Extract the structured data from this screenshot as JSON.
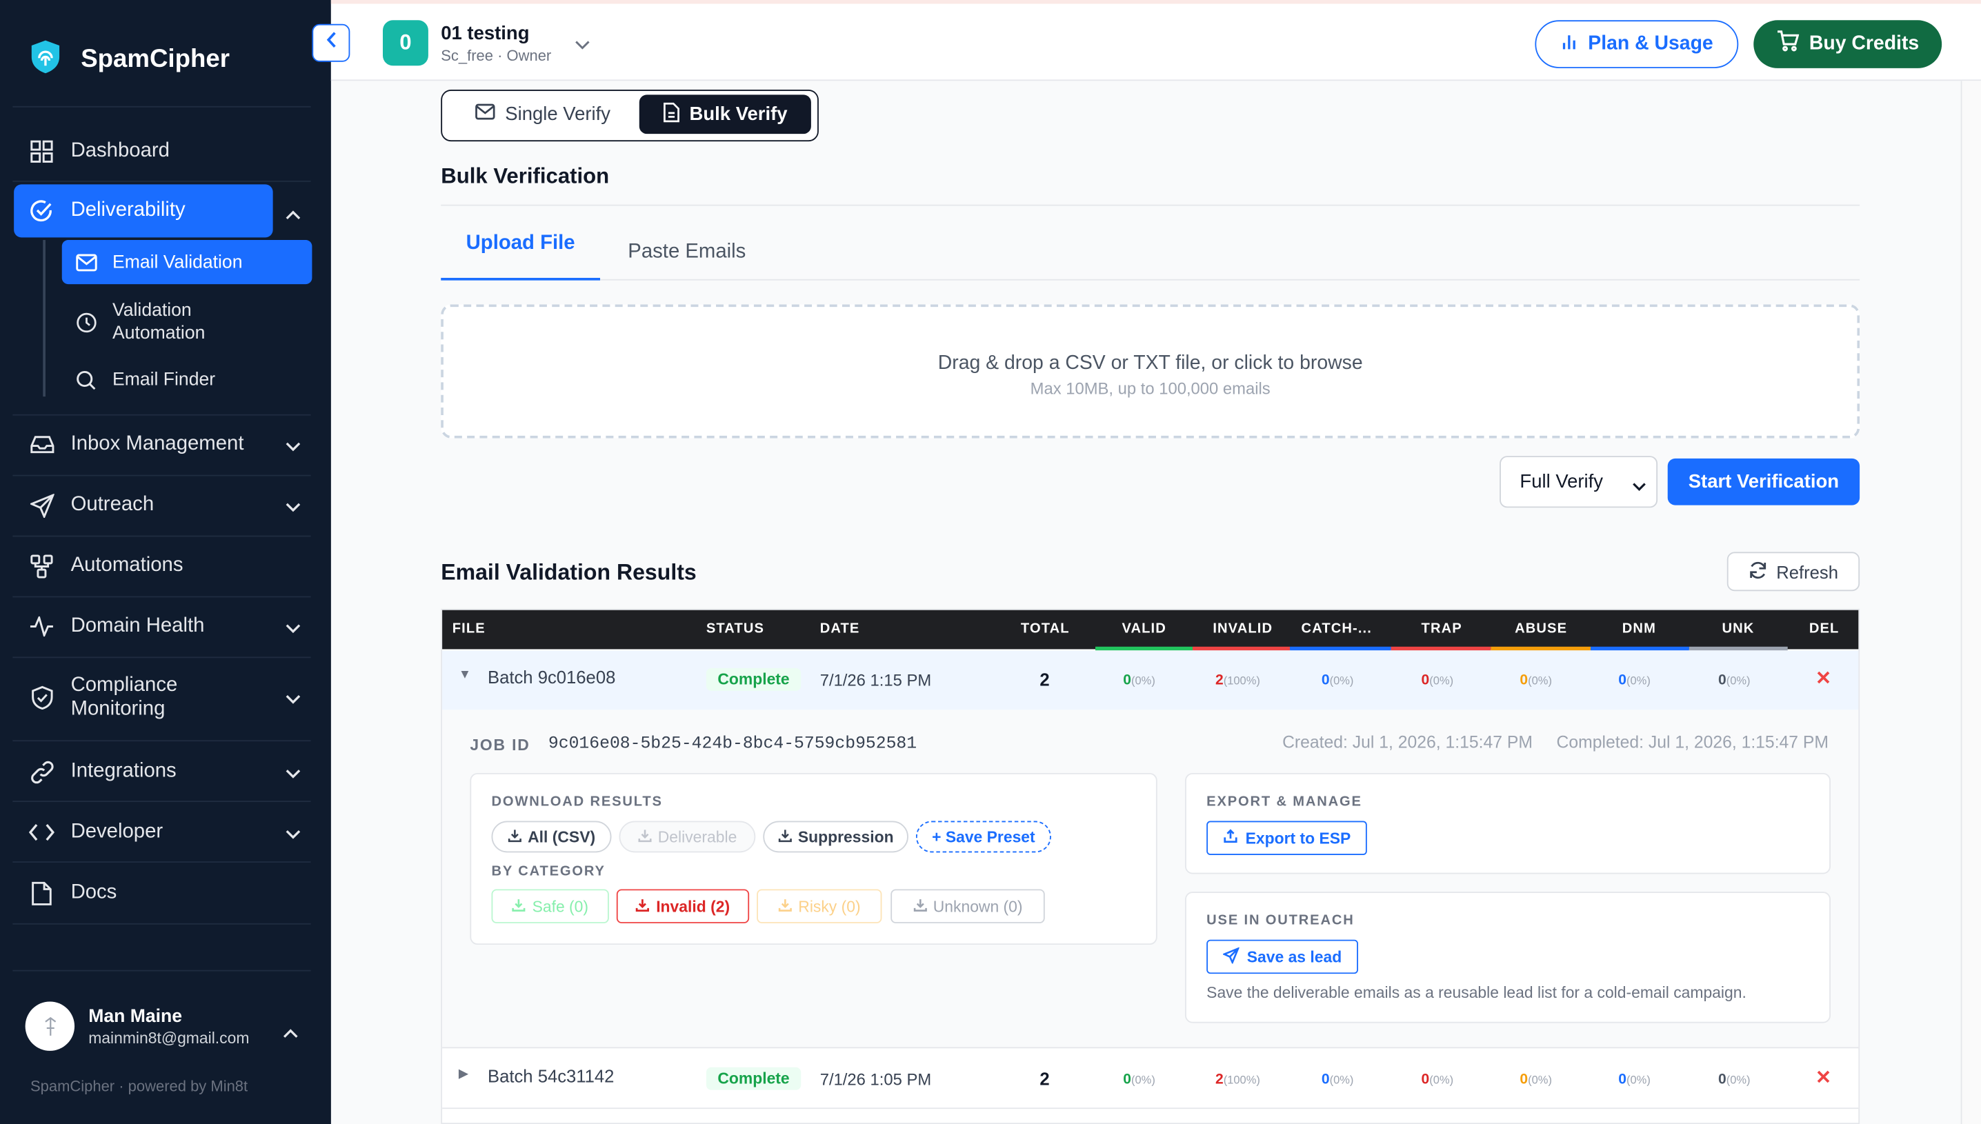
{
  "app": {
    "name": "SpamCipher"
  },
  "sidebar": {
    "items": [
      {
        "label": "Dashboard",
        "icon": "grid-icon"
      },
      {
        "label": "Deliverability",
        "icon": "check-circle-icon"
      },
      {
        "label": "Inbox Management",
        "icon": "inbox-icon"
      },
      {
        "label": "Outreach",
        "icon": "send-icon"
      },
      {
        "label": "Automations",
        "icon": "workflow-icon"
      },
      {
        "label": "Domain Health",
        "icon": "activity-icon"
      },
      {
        "label": "Compliance Monitoring",
        "icon": "shield-check-icon"
      },
      {
        "label": "Integrations",
        "icon": "link-icon"
      },
      {
        "label": "Developer",
        "icon": "code-icon"
      },
      {
        "label": "Docs",
        "icon": "file-icon"
      }
    ],
    "subitems": [
      {
        "label": "Email Validation",
        "icon": "mail-icon"
      },
      {
        "label": "Validation Automation",
        "icon": "clock-icon"
      },
      {
        "label": "Email Finder",
        "icon": "search-icon"
      }
    ],
    "user": {
      "name": "Man Maine",
      "email": "mainmin8t@gmail.com"
    },
    "footer": "SpamCipher · powered by Min8t"
  },
  "topbar": {
    "org_initial": "0",
    "org_name": "01 testing",
    "org_sub": "Sc_free · Owner",
    "plan_label": "Plan & Usage",
    "buy_label": "Buy Credits"
  },
  "verify_toggle": {
    "single": "Single Verify",
    "bulk": "Bulk Verify"
  },
  "bulk": {
    "title": "Bulk Verification",
    "tabs": {
      "upload": "Upload File",
      "paste": "Paste Emails"
    },
    "dropzone": {
      "main": "Drag & drop a CSV or TXT file, or click to browse",
      "sub": "Max 10MB, up to 100,000 emails"
    },
    "mode": "Full Verify",
    "start_label": "Start Verification"
  },
  "results": {
    "title": "Email Validation Results",
    "refresh_label": "Refresh",
    "columns": [
      "FILE",
      "STATUS",
      "DATE",
      "TOTAL",
      "VALID",
      "INVALID",
      "CATCH-...",
      "TRAP",
      "ABUSE",
      "DNM",
      "UNK",
      "DEL"
    ],
    "column_colors": {
      "valid": "#22c55e",
      "invalid": "#ef4444",
      "catch": "#1a6dff",
      "trap": "#ef4444",
      "abuse": "#f59e0b",
      "dnm": "#1a6dff",
      "unk": "#9ca3af"
    },
    "rows": [
      {
        "file": "Batch 9c016e08",
        "status": "Complete",
        "date": "7/1/26 1:15 PM",
        "total": "2",
        "valid": "0",
        "valid_pct": "(0%)",
        "invalid": "2",
        "invalid_pct": "(100%)",
        "catch": "0",
        "catch_pct": "(0%)",
        "trap": "0",
        "trap_pct": "(0%)",
        "abuse": "0",
        "abuse_pct": "(0%)",
        "dnm": "0",
        "dnm_pct": "(0%)",
        "unk": "0",
        "unk_pct": "(0%)"
      },
      {
        "file": "Batch 54c31142",
        "status": "Complete",
        "date": "7/1/26 1:05 PM",
        "total": "2",
        "valid": "0",
        "valid_pct": "(0%)",
        "invalid": "2",
        "invalid_pct": "(100%)",
        "catch": "0",
        "catch_pct": "(0%)",
        "trap": "0",
        "trap_pct": "(0%)",
        "abuse": "0",
        "abuse_pct": "(0%)",
        "dnm": "0",
        "dnm_pct": "(0%)",
        "unk": "0",
        "unk_pct": "(0%)"
      }
    ],
    "detail": {
      "job_label": "JOB ID",
      "job_id": "9c016e08-5b25-424b-8bc4-5759cb952581",
      "created": "Created: Jul 1, 2026, 1:15:47 PM",
      "completed": "Completed: Jul 1, 2026, 1:15:47 PM",
      "download_title": "DOWNLOAD RESULTS",
      "download_buttons": [
        "All (CSV)",
        "Deliverable",
        "Suppression"
      ],
      "save_preset": "+ Save Preset",
      "category_title": "BY CATEGORY",
      "categories": [
        "Safe (0)",
        "Invalid (2)",
        "Risky (0)",
        "Unknown (0)"
      ],
      "export_title": "EXPORT & MANAGE",
      "export_label": "Export to ESP",
      "outreach_title": "USE IN OUTREACH",
      "save_lead_label": "Save as lead",
      "outreach_desc": "Save the deliverable emails as a reusable lead list for a cold-email campaign."
    }
  }
}
